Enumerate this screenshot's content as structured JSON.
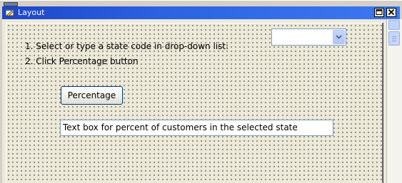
{
  "window": {
    "title": "Layout",
    "icon": "form-design-icon",
    "titlebar_color": "#2b63e0"
  },
  "form": {
    "instructions": [
      "1. Select or type a state code in drop-down list:",
      "2. Click Percentage button"
    ],
    "state_combo": {
      "value": "",
      "icon": "chevron-down-icon"
    },
    "percentage_button_label": "Percentage",
    "percent_textbox_text": "Text box for percent of customers in the selected state"
  },
  "colors": {
    "form_background": "#ece9d8",
    "grid_dots": "#3c3c3c",
    "control_border": "#7f9db9"
  }
}
